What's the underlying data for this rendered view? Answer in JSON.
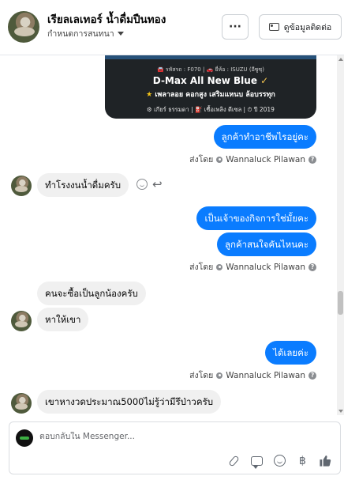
{
  "header": {
    "page_name": "เรียลเลเทอร์ น้ำดื่มปืนทอง",
    "assign_label": "กำหนดการสนทนา",
    "more_label": "···",
    "contact_label": "ดูข้อมูลติดต่อ"
  },
  "promo_card": {
    "spec_line": "🚘 รหัสรถ : F070 | 🚗 ยี่ห้อ : ISUZU (อีซูซุ)",
    "title": "D-Max All New Blue",
    "title_check": "✓",
    "subtitle_star": "★",
    "subtitle": "เพลาลอย คอกสูง เสริมแหนบ ล้อบรรทุก",
    "meta": "⚙ เกียร์ ธรรมดา  |  ⛽ เชื้อเพลิง ดีเซล  |  ⏱ ปี 2019"
  },
  "messages": [
    {
      "id": "m1",
      "direction": "out",
      "text": "ลูกค้าทำอาชีพไรอยู่คะ"
    },
    {
      "id": "m2",
      "direction": "in",
      "text": "ทำโรงงนน้ำดื่มครับ"
    },
    {
      "id": "m3",
      "direction": "out",
      "text": "เป็นเจ้าของกิจการใช่มั้ยคะ"
    },
    {
      "id": "m4",
      "direction": "out",
      "text": "ลูกค้าสนใจคันไหนคะ"
    },
    {
      "id": "m5",
      "direction": "in",
      "text": "คนจะซื้อเป็นลูกน้องครับ"
    },
    {
      "id": "m6",
      "direction": "in",
      "text": "หาให้เขา"
    },
    {
      "id": "m7",
      "direction": "out",
      "text": "ได้เลยค่ะ"
    },
    {
      "id": "m8",
      "direction": "in",
      "text": "เขาหางวดประมาณ5000ไม่รู้ว่ามีรึป่าวครับ"
    }
  ],
  "sent_by": {
    "prefix": "ส่งโดย",
    "agent_name": "Wannaluck Pilawan",
    "help": "?"
  },
  "composer": {
    "placeholder": "ตอบกลับใน Messenger...",
    "value": ""
  },
  "icons": {
    "reply": "reply-icon",
    "react": "smile-icon",
    "attach": "paperclip-icon",
    "saved_reply": "chat-bubble-icon",
    "emoji": "emoji-icon",
    "payment": "baht-icon",
    "like": "thumbs-up-icon"
  },
  "colors": {
    "outgoing_bubble": "#0a7cff",
    "incoming_bubble": "#f0f0f0",
    "promo_bg": "#1f2326",
    "accent": "#1877f2"
  }
}
